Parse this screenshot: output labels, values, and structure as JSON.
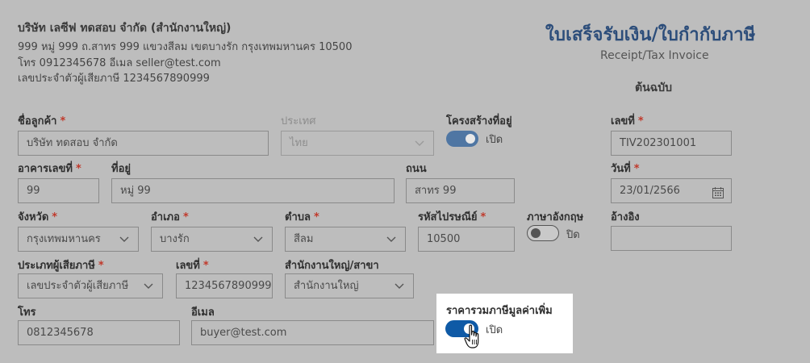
{
  "seller": {
    "name": "บริษัท เลซีฟ ทดสอบ จำกัด (สำนักงานใหญ่)",
    "address": "999 หมู่ 999 ถ.สาทร 999 แขวงสีลม เขตบางรัก กรุงเทพมหานคร 10500",
    "contact": "โทร 0912345678 อีเมล seller@test.com",
    "tax_id": "เลขประจำตัวผู้เสียภาษี 1234567890999"
  },
  "document": {
    "title_th": "ใบเสร็จรับเงิน/ใบกำกับภาษี",
    "title_en": "Receipt/Tax Invoice",
    "copy_label": "ต้นฉบับ"
  },
  "required_mark": "*",
  "form": {
    "customer_name": {
      "label": "ชื่อลูกค้า",
      "value": "บริษัท ทดสอบ จำกัด"
    },
    "country": {
      "label": "ประเทศ",
      "value": "ไทย",
      "disabled": true
    },
    "address_structure": {
      "label": "โครงสร้างที่อยู่",
      "state": "เปิด",
      "on": true
    },
    "doc_number": {
      "label": "เลขที่",
      "value": "TIV202301001"
    },
    "building_no": {
      "label": "อาคารเลขที่",
      "value": "99"
    },
    "address": {
      "label": "ที่อยู่",
      "value": "หมู่ 99"
    },
    "road": {
      "label": "ถนน",
      "value": "สาทร 99"
    },
    "date": {
      "label": "วันที่",
      "value": "23/01/2566"
    },
    "province": {
      "label": "จังหวัด",
      "value": "กรุงเทพมหานคร"
    },
    "district": {
      "label": "อำเภอ",
      "value": "บางรัก"
    },
    "subdistrict": {
      "label": "ตำบล",
      "value": "สีลม"
    },
    "postal_code": {
      "label": "รหัสไปรษณีย์",
      "value": "10500"
    },
    "english": {
      "label": "ภาษาอังกฤษ",
      "state": "ปิด",
      "on": false
    },
    "reference": {
      "label": "อ้างอิง",
      "value": ""
    },
    "taxpayer_type": {
      "label": "ประเภทผู้เสียภาษี",
      "value": "เลขประจำตัวผู้เสียภาษี"
    },
    "tax_number": {
      "label": "เลขที่",
      "value": "1234567890999"
    },
    "branch": {
      "label": "สำนักงานใหญ่/สาขา",
      "value": "สำนักงานใหญ่"
    },
    "phone": {
      "label": "โทร",
      "value": "0812345678"
    },
    "email": {
      "label": "อีเมล",
      "value": "buyer@test.com"
    },
    "vat_included": {
      "label": "ราคารวมภาษีมูลค่าเพิ่ม",
      "state": "เปิด",
      "on": true
    }
  },
  "colors": {
    "overlay": "#bdbdbd",
    "title": "#2c4d7a",
    "required": "#c0392b",
    "toggle_on_dim": "#4f76a3",
    "toggle_on": "#0f5aa6"
  }
}
